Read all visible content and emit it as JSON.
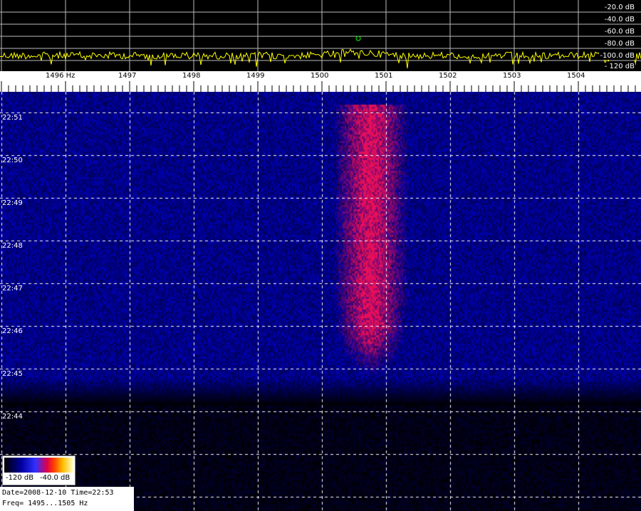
{
  "spectrum": {
    "db_labels": [
      "-20.0 dB",
      "-40.0 dB",
      "-60.0 dB",
      "-80.0 dB",
      "-100.0 dB",
      "- 120 dB"
    ],
    "trace_color": "#ffff00",
    "marker_color": "#00ff00"
  },
  "frequency_axis": {
    "labels": [
      "1496 Hz",
      "1497",
      "1498",
      "1499",
      "1500",
      "1501",
      "1502",
      "1503",
      "1504"
    ]
  },
  "waterfall": {
    "time_labels": [
      "22:51",
      "22:50",
      "22:49",
      "22:48",
      "22:47",
      "22:46",
      "22:45",
      "22:44"
    ],
    "background_color": "#000000",
    "noise_color": "#0000ff",
    "signal_color": "#e0105a"
  },
  "colorbar": {
    "min_label": "-120 dB",
    "max_label": "-40.0 dB"
  },
  "info": {
    "date_time": "Date=2008-12-10 Time=22:53",
    "freq_range": "Freq= 1495...1505 Hz"
  }
}
